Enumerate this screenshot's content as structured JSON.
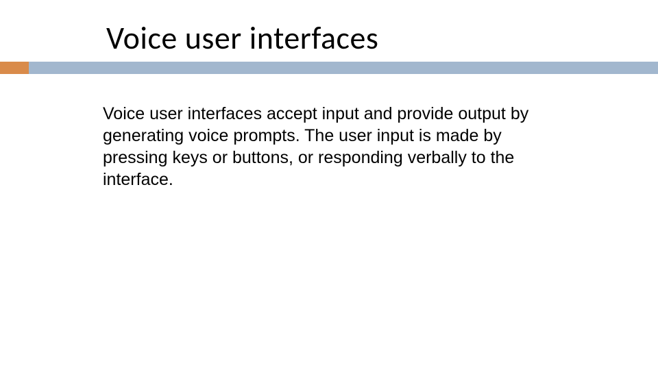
{
  "slide": {
    "title": "Voice user interfaces",
    "body": "Voice user interfaces accept input and provide output by generating voice prompts. The user input is made by pressing keys or buttons, or responding verbally to the interface."
  },
  "colors": {
    "bar": "#a2b7ce",
    "accent": "#d98b4a"
  }
}
